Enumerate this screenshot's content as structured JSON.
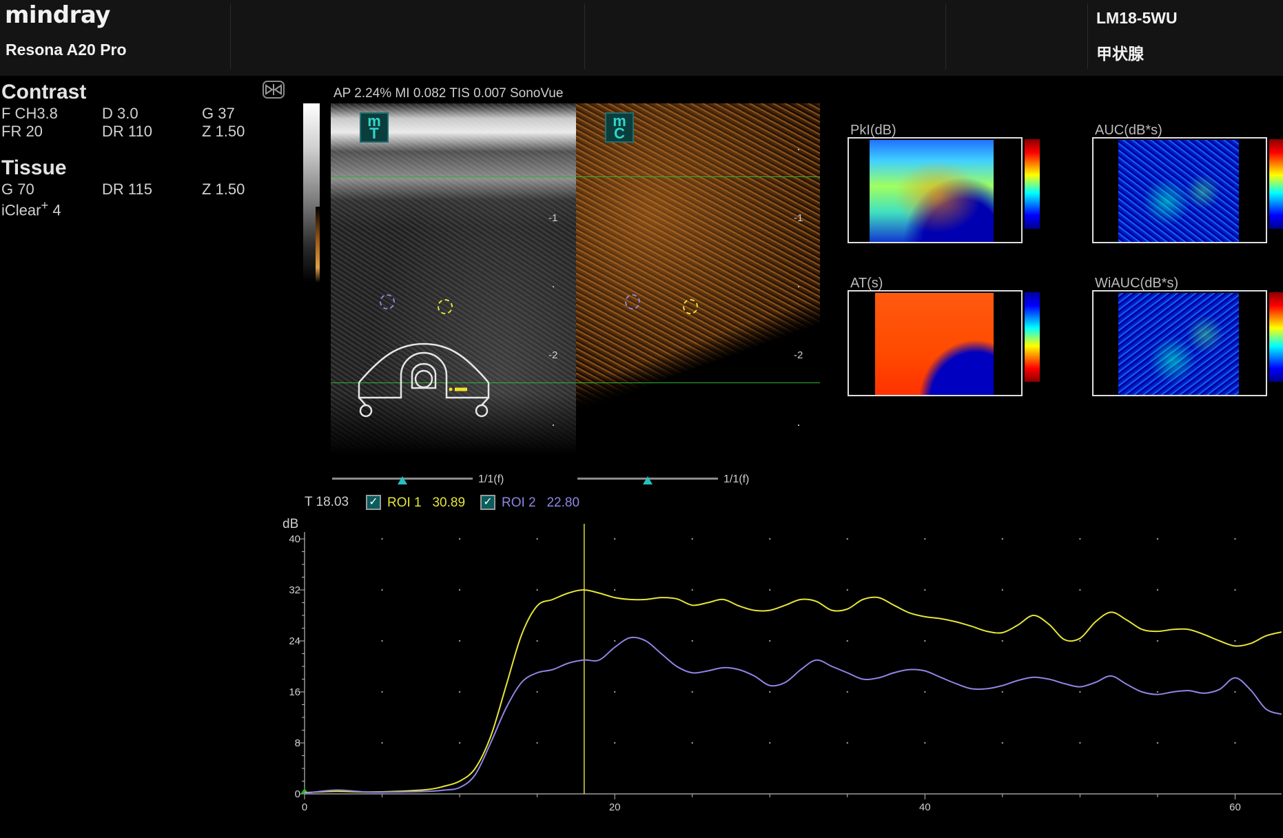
{
  "header": {
    "brand": "mindray",
    "model": "Resona A20 Pro",
    "probe": "LM18-5WU",
    "preset": "甲状腺"
  },
  "params": {
    "contrast_title": "Contrast",
    "contrast_row1": [
      "F CH3.8",
      "D 3.0",
      "G 37"
    ],
    "contrast_row2": [
      "FR 20",
      "DR 110",
      "Z 1.50"
    ],
    "tissue_title": "Tissue",
    "tissue_row1": [
      "G 70",
      "DR 115",
      "Z 1.50"
    ],
    "iclear_label": "iClear",
    "iclear_sup": "+",
    "iclear_value": "4"
  },
  "image": {
    "header_text": "AP 2.24%  MI 0.082 TIS 0.007  SonoVue",
    "tissue_badge_top": "m",
    "tissue_badge_bottom": "T",
    "contrast_badge_top": "m",
    "contrast_badge_bottom": "C",
    "depth_marks": [
      "-1",
      "-2"
    ],
    "left_frame_label": "1/1(f)",
    "right_frame_label": "1/1(f)"
  },
  "maps": {
    "pki_title": "PkI(dB)",
    "auc_title": "AUC(dB*s)",
    "at_title": "AT(s)",
    "wiauc_title": "WiAUC(dB*s)"
  },
  "colors": {
    "roi1": "#e6e63a",
    "roi2": "#8f86e6",
    "cursor": "#d8d84a",
    "axis": "#bdbdbd",
    "badge": "#2fd7c8"
  },
  "tic": {
    "time_readout": "T 18.03",
    "roi1_label": "ROI 1",
    "roi1_value": "30.89",
    "roi2_label": "ROI 2",
    "roi2_value": "22.80"
  },
  "chart_data": {
    "type": "line",
    "ylabel": "dB",
    "xlim": [
      0,
      63
    ],
    "ylim": [
      0,
      40
    ],
    "x_ticks": [
      0,
      20,
      40,
      60
    ],
    "y_ticks": [
      0,
      8,
      16,
      24,
      32,
      40
    ],
    "cursor_x": 18.03,
    "grid": "dotted",
    "series": [
      {
        "name": "ROI 1",
        "x": [
          0,
          2,
          4,
          6,
          8,
          9,
          10,
          11,
          12,
          13,
          14,
          15,
          16,
          17,
          18,
          19,
          20,
          21,
          22,
          23,
          24,
          25,
          26,
          27,
          28,
          29,
          30,
          31,
          32,
          33,
          34,
          35,
          36,
          37,
          38,
          39,
          40,
          41,
          42,
          43,
          44,
          45,
          46,
          47,
          48,
          49,
          50,
          51,
          52,
          53,
          54,
          55,
          56,
          57,
          58,
          59,
          60,
          61,
          62,
          63
        ],
        "values": [
          0.2,
          0.4,
          0.3,
          0.4,
          0.7,
          1.2,
          2.0,
          4.0,
          9.0,
          17.0,
          25.0,
          29.5,
          30.5,
          31.5,
          32.0,
          31.5,
          30.8,
          30.5,
          30.5,
          30.8,
          30.6,
          29.6,
          30.0,
          30.5,
          29.5,
          28.8,
          28.8,
          29.6,
          30.5,
          30.2,
          28.8,
          29.0,
          30.5,
          30.8,
          29.6,
          28.4,
          27.8,
          27.5,
          27.0,
          26.3,
          25.5,
          25.3,
          26.5,
          28.0,
          26.6,
          24.2,
          24.4,
          27.0,
          28.5,
          27.3,
          25.8,
          25.5,
          25.8,
          25.8,
          25.0,
          24.0,
          23.2,
          23.6,
          24.8,
          25.4
        ]
      },
      {
        "name": "ROI 2",
        "x": [
          0,
          2,
          4,
          6,
          8,
          9,
          10,
          11,
          12,
          13,
          14,
          15,
          16,
          17,
          18,
          19,
          20,
          21,
          22,
          23,
          24,
          25,
          26,
          27,
          28,
          29,
          30,
          31,
          32,
          33,
          34,
          35,
          36,
          37,
          38,
          39,
          40,
          41,
          42,
          43,
          44,
          45,
          46,
          47,
          48,
          49,
          50,
          51,
          52,
          53,
          54,
          55,
          56,
          57,
          58,
          59,
          60,
          61,
          62,
          63
        ],
        "values": [
          0.1,
          0.6,
          0.3,
          0.3,
          0.4,
          0.6,
          1.0,
          3.0,
          8.0,
          13.5,
          17.5,
          19.0,
          19.5,
          20.5,
          21.0,
          21.0,
          23.0,
          24.5,
          24.0,
          22.0,
          20.0,
          19.0,
          19.3,
          19.8,
          19.5,
          18.5,
          17.0,
          17.5,
          19.5,
          21.0,
          20.0,
          19.0,
          18.0,
          18.2,
          19.0,
          19.5,
          19.3,
          18.3,
          17.3,
          16.5,
          16.5,
          17.0,
          17.8,
          18.3,
          18.0,
          17.3,
          16.8,
          17.5,
          18.5,
          17.2,
          16.0,
          15.6,
          16.0,
          16.2,
          15.8,
          16.4,
          18.2,
          16.3,
          13.3,
          12.5
        ]
      }
    ]
  }
}
